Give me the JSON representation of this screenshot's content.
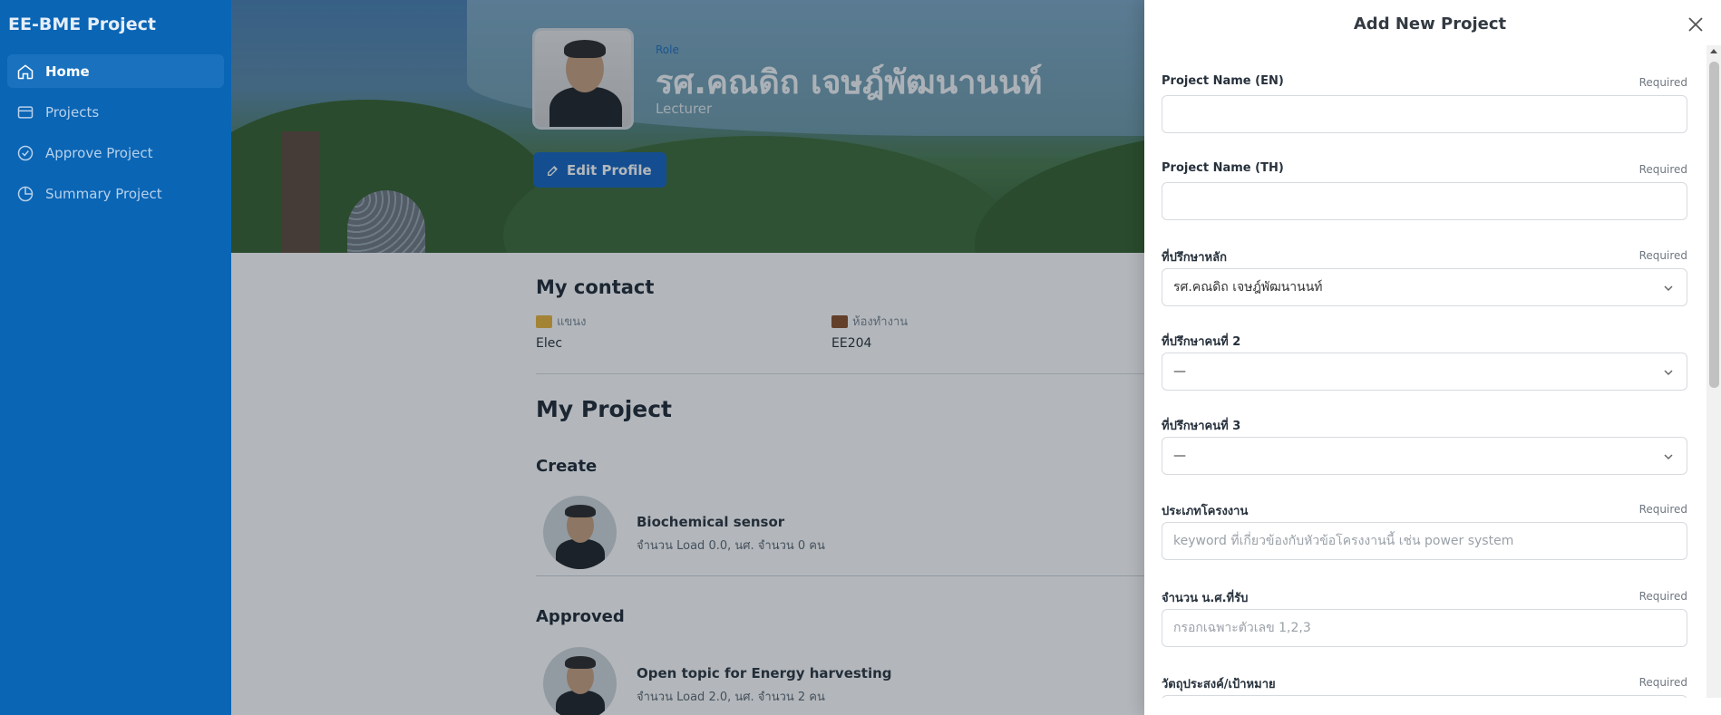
{
  "sidebar": {
    "brand": "EE-BME Project",
    "items": [
      {
        "label": "Home",
        "icon": "home-icon",
        "active": true
      },
      {
        "label": "Projects",
        "icon": "card-icon",
        "active": false
      },
      {
        "label": "Approve Project",
        "icon": "check-circle-icon",
        "active": false
      },
      {
        "label": "Summary Project",
        "icon": "pie-chart-icon",
        "active": false
      }
    ]
  },
  "profile": {
    "role_small": "Role",
    "name": "รศ.คณดิถ เจษฎ์พัฒนานนท์",
    "role": "Lecturer",
    "edit_label": "Edit Profile"
  },
  "contact": {
    "title": "My contact",
    "branch_label": "แขนง",
    "branch_value": "Elec",
    "office_label": "ห้องทำงาน",
    "office_value": "EE204"
  },
  "projects": {
    "title": "My Project",
    "create_title": "Create",
    "create_items": [
      {
        "title": "Biochemical sensor",
        "meta": "จำนวน Load 0.0, นศ. จำนวน 0 คน"
      }
    ],
    "approved_title": "Approved",
    "approved_items": [
      {
        "title": "Open topic for Energy harvesting",
        "meta": "จำนวน Load 2.0, นศ. จำนวน 2 คน"
      }
    ]
  },
  "drawer": {
    "title": "Add New Project",
    "fields": [
      {
        "label": "Project Name (EN)",
        "required": "Required",
        "value": "",
        "placeholder": "",
        "type": "text"
      },
      {
        "label": "Project Name (TH)",
        "required": "Required",
        "value": "",
        "placeholder": "",
        "type": "text"
      },
      {
        "label": "ที่ปรึกษาหลัก",
        "required": "Required",
        "value": "รศ.คณดิถ เจษฎ์พัฒนานนท์",
        "placeholder": "",
        "type": "select"
      },
      {
        "label": "ที่ปรึกษาคนที่ 2",
        "required": "",
        "value": "—",
        "placeholder": "",
        "type": "select"
      },
      {
        "label": "ที่ปรึกษาคนที่ 3",
        "required": "",
        "value": "—",
        "placeholder": "",
        "type": "select"
      },
      {
        "label": "ประเภทโครงงาน",
        "required": "Required",
        "value": "",
        "placeholder": "keyword ที่เกี่ยวข้องกับหัวข้อโครงงานนี้ เช่น power system",
        "type": "text"
      },
      {
        "label": "จำนวน น.ศ.ที่รับ",
        "required": "Required",
        "value": "",
        "placeholder": "กรอกเฉพาะตัวเลข 1,2,3",
        "type": "text"
      },
      {
        "label": "วัตถุประสงค์/เป้าหมาย",
        "required": "Required",
        "value": "",
        "placeholder": "",
        "type": "text"
      }
    ]
  },
  "colors": {
    "sidebar": "#0a65b5",
    "primary_button": "#1565c0"
  }
}
